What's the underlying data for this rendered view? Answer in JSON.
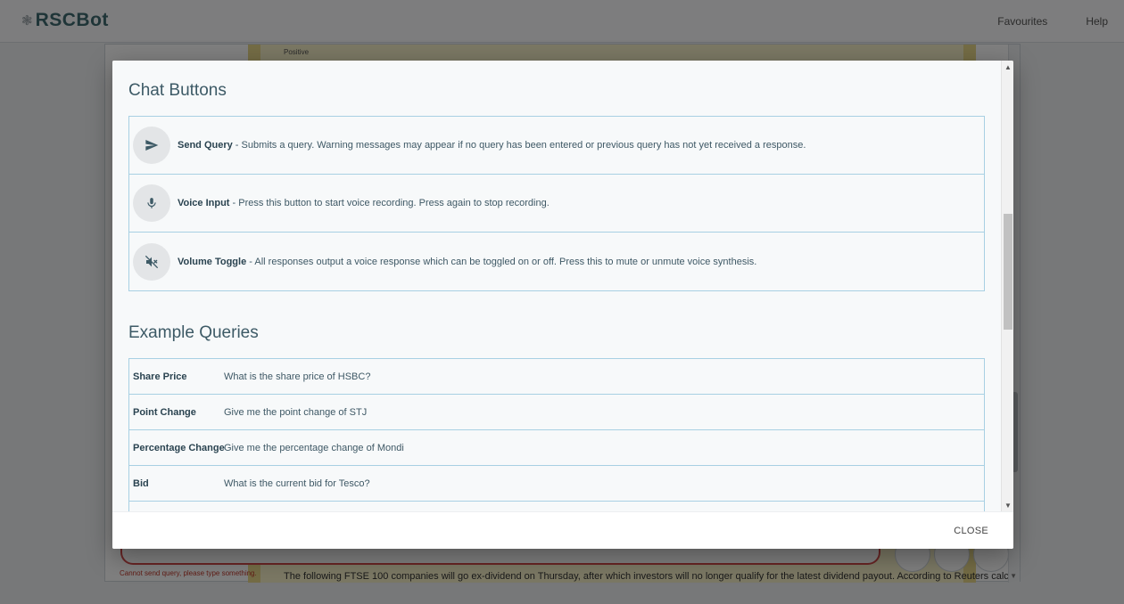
{
  "app": {
    "brand": "RSCBot",
    "nav": {
      "favourites": "Favourites",
      "help": "Help"
    }
  },
  "background": {
    "sentiment": "Positive",
    "input_warning": "Cannot send query, please type something.",
    "news_text": "The following FTSE 100 companies will go ex-dividend on Thursday, after which investors will no longer qualify for the latest dividend payout. According to Reuters calc..."
  },
  "modal": {
    "chat_buttons_title": "Chat Buttons",
    "buttons": [
      {
        "name": "Send Query",
        "icon": "send-icon",
        "description": " - Submits a query. Warning messages may appear if no query has been entered or previous query has not yet received a response."
      },
      {
        "name": "Voice Input",
        "icon": "microphone-icon",
        "description": " - Press this button to start voice recording. Press again to stop recording."
      },
      {
        "name": "Volume Toggle",
        "icon": "volume-off-icon",
        "description": " - All responses output a voice response which can be toggled on or off. Press this to mute or unmute voice synthesis."
      }
    ],
    "example_queries_title": "Example Queries",
    "queries": [
      {
        "name": "Share Price",
        "example": "What is the share price of HSBC?"
      },
      {
        "name": "Point Change",
        "example": "Give me the point change of STJ"
      },
      {
        "name": "Percentage Change",
        "example": "Give me the percentage change of Mondi"
      },
      {
        "name": "Bid",
        "example": "What is the current bid for Tesco?"
      }
    ],
    "close_label": "CLOSE"
  },
  "colors": {
    "accent": "#3f6a70",
    "table_border": "#a8d0e3",
    "warning": "#c0392b",
    "feed_background": "#f6f0c9"
  }
}
